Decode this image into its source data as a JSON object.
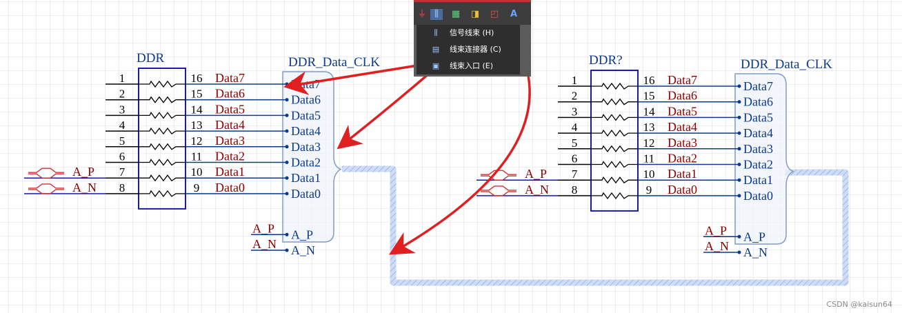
{
  "left_block": {
    "component_ref": "DDR",
    "harness_title": "DDR_Data_CLK",
    "pin_rows": [
      {
        "left_pin": "1",
        "right_pin": "16",
        "net": "Data7"
      },
      {
        "left_pin": "2",
        "right_pin": "15",
        "net": "Data6"
      },
      {
        "left_pin": "3",
        "right_pin": "14",
        "net": "Data5"
      },
      {
        "left_pin": "4",
        "right_pin": "13",
        "net": "Data4"
      },
      {
        "left_pin": "5",
        "right_pin": "12",
        "net": "Data3"
      },
      {
        "left_pin": "6",
        "right_pin": "11",
        "net": "Data2"
      },
      {
        "left_pin": "7",
        "right_pin": "10",
        "net": "Data1"
      },
      {
        "left_pin": "8",
        "right_pin": "9",
        "net": "Data0"
      }
    ],
    "harness_entries": [
      "Data7",
      "Data6",
      "Data5",
      "Data4",
      "Data3",
      "Data2",
      "Data1",
      "Data0"
    ],
    "ports": [
      "A_P",
      "A_N"
    ],
    "bottom_nets": [
      "A_P",
      "A_N"
    ],
    "bottom_entries": [
      "A_P",
      "A_N"
    ]
  },
  "right_block": {
    "component_ref": "DDR?",
    "harness_title": "DDR_Data_CLK",
    "pin_rows": [
      {
        "left_pin": "1",
        "right_pin": "16",
        "net": "Data7"
      },
      {
        "left_pin": "2",
        "right_pin": "15",
        "net": "Data6"
      },
      {
        "left_pin": "3",
        "right_pin": "14",
        "net": "Data5"
      },
      {
        "left_pin": "4",
        "right_pin": "13",
        "net": "Data4"
      },
      {
        "left_pin": "5",
        "right_pin": "12",
        "net": "Data3"
      },
      {
        "left_pin": "6",
        "right_pin": "11",
        "net": "Data2"
      },
      {
        "left_pin": "7",
        "right_pin": "10",
        "net": "Data1"
      },
      {
        "left_pin": "8",
        "right_pin": "9",
        "net": "Data0"
      }
    ],
    "harness_entries": [
      "Data7",
      "Data6",
      "Data5",
      "Data4",
      "Data3",
      "Data2",
      "Data1",
      "Data0"
    ],
    "ports": [
      "A_P",
      "A_N"
    ],
    "bottom_nets": [
      "A_P",
      "A_N"
    ],
    "bottom_entries": [
      "A_P",
      "A_N"
    ]
  },
  "toolbar": {
    "icons": [
      "ground-icon",
      "signal-harness-icon",
      "harness-connector-icon",
      "net-label-icon",
      "port-icon",
      "text-icon"
    ],
    "menu_items": [
      {
        "label": "信号线束 (H)",
        "icon": "signal-harness-icon"
      },
      {
        "label": "线束连接器 (C)",
        "icon": "harness-connector-icon"
      },
      {
        "label": "线束入口 (E)",
        "icon": "harness-entry-icon"
      }
    ]
  },
  "colors": {
    "net_label": "#8b0000",
    "entry_text": "#0d3a8c",
    "component_outline": "#1a1aa8",
    "harness_bus": "#a8c4f0",
    "arrow": "#e02020",
    "grid": "#dcdcdc"
  },
  "watermark": "CSDN @kaisun64"
}
